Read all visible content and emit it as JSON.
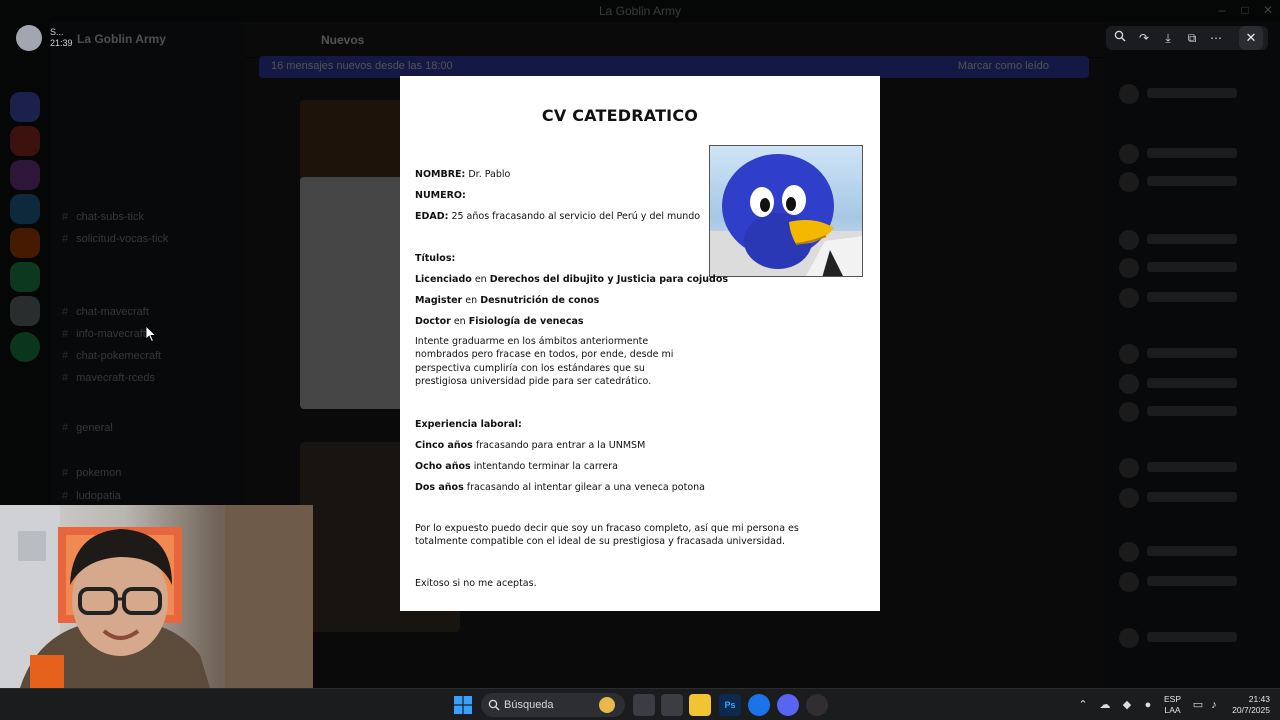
{
  "app": {
    "window_title": "La Goblin Army",
    "server_name": "La Goblin Army",
    "user": {
      "name": "S...",
      "time": "21:39"
    },
    "channels": [
      "chat-subs-tick",
      "solicitud-vocas-tick",
      "chat-mavecraft",
      "info-mavecraft",
      "chat-pokemecraft",
      "mavecraft-rceds",
      "general",
      "pokemon",
      "ludopatia"
    ],
    "header_channel": "Nuevos",
    "banner_text": "16 mensajes nuevos desde las 18:00",
    "banner_action": "Marcar como leído"
  },
  "viewer": {
    "toolbar": {
      "zoom_icon": "zoom-icon",
      "forward_icon": "forward-icon",
      "download_icon": "download-icon",
      "open_icon": "open-external-icon",
      "more_icon": "more-icon"
    },
    "close_icon": "close-icon"
  },
  "document": {
    "title": "CV CATEDRATICO",
    "nombre_label": "NOMBRE:",
    "nombre_value": "Dr. Pablo",
    "numero_label": "NUMERO:",
    "edad_label": "EDAD:",
    "edad_value": "25 años fracasando al servicio del Perú y del mundo",
    "titulos_heading": "Títulos:",
    "titulos": [
      {
        "grado": "Licenciado",
        "en": "en",
        "campo": "Derechos del dibujito y Justicia para cojudos"
      },
      {
        "grado": "Magister",
        "en": "en",
        "campo": "Desnutrición de conos"
      },
      {
        "grado": "Doctor",
        "en": "en",
        "campo": "Fisiología de venecas"
      }
    ],
    "intro_paragraph": "Intente graduarme en los ámbitos anteriormente nombrados pero fracase en todos, por ende, desde mi perspectiva cumpliría con los estándares que su prestigiosa universidad pide para ser catedrático.",
    "experiencia_heading": "Experiencia laboral:",
    "experiencia": [
      {
        "periodo": "Cinco años",
        "detalle": "fracasando para entrar a la UNMSM"
      },
      {
        "periodo": "Ocho años",
        "detalle": "intentando terminar la carrera"
      },
      {
        "periodo": "Dos años",
        "detalle": "fracasando al intentar gilear a una veneca potona"
      }
    ],
    "closing_paragraph": "Por lo expuesto puedo decir que soy un fracaso completo, así que mi persona es totalmente compatible con el ideal de su prestigiosa y fracasada universidad.",
    "signoff": "Exitoso si no me aceptas."
  },
  "taskbar": {
    "search_placeholder": "Búsqueda",
    "lang_line1": "ESP",
    "lang_line2": "LAA",
    "time": "21:43",
    "date": "20/7/2025",
    "apps": [
      "file-explorer-icon",
      "photoshop-icon",
      "chrome-icon",
      "discord-icon",
      "obs-icon"
    ]
  }
}
